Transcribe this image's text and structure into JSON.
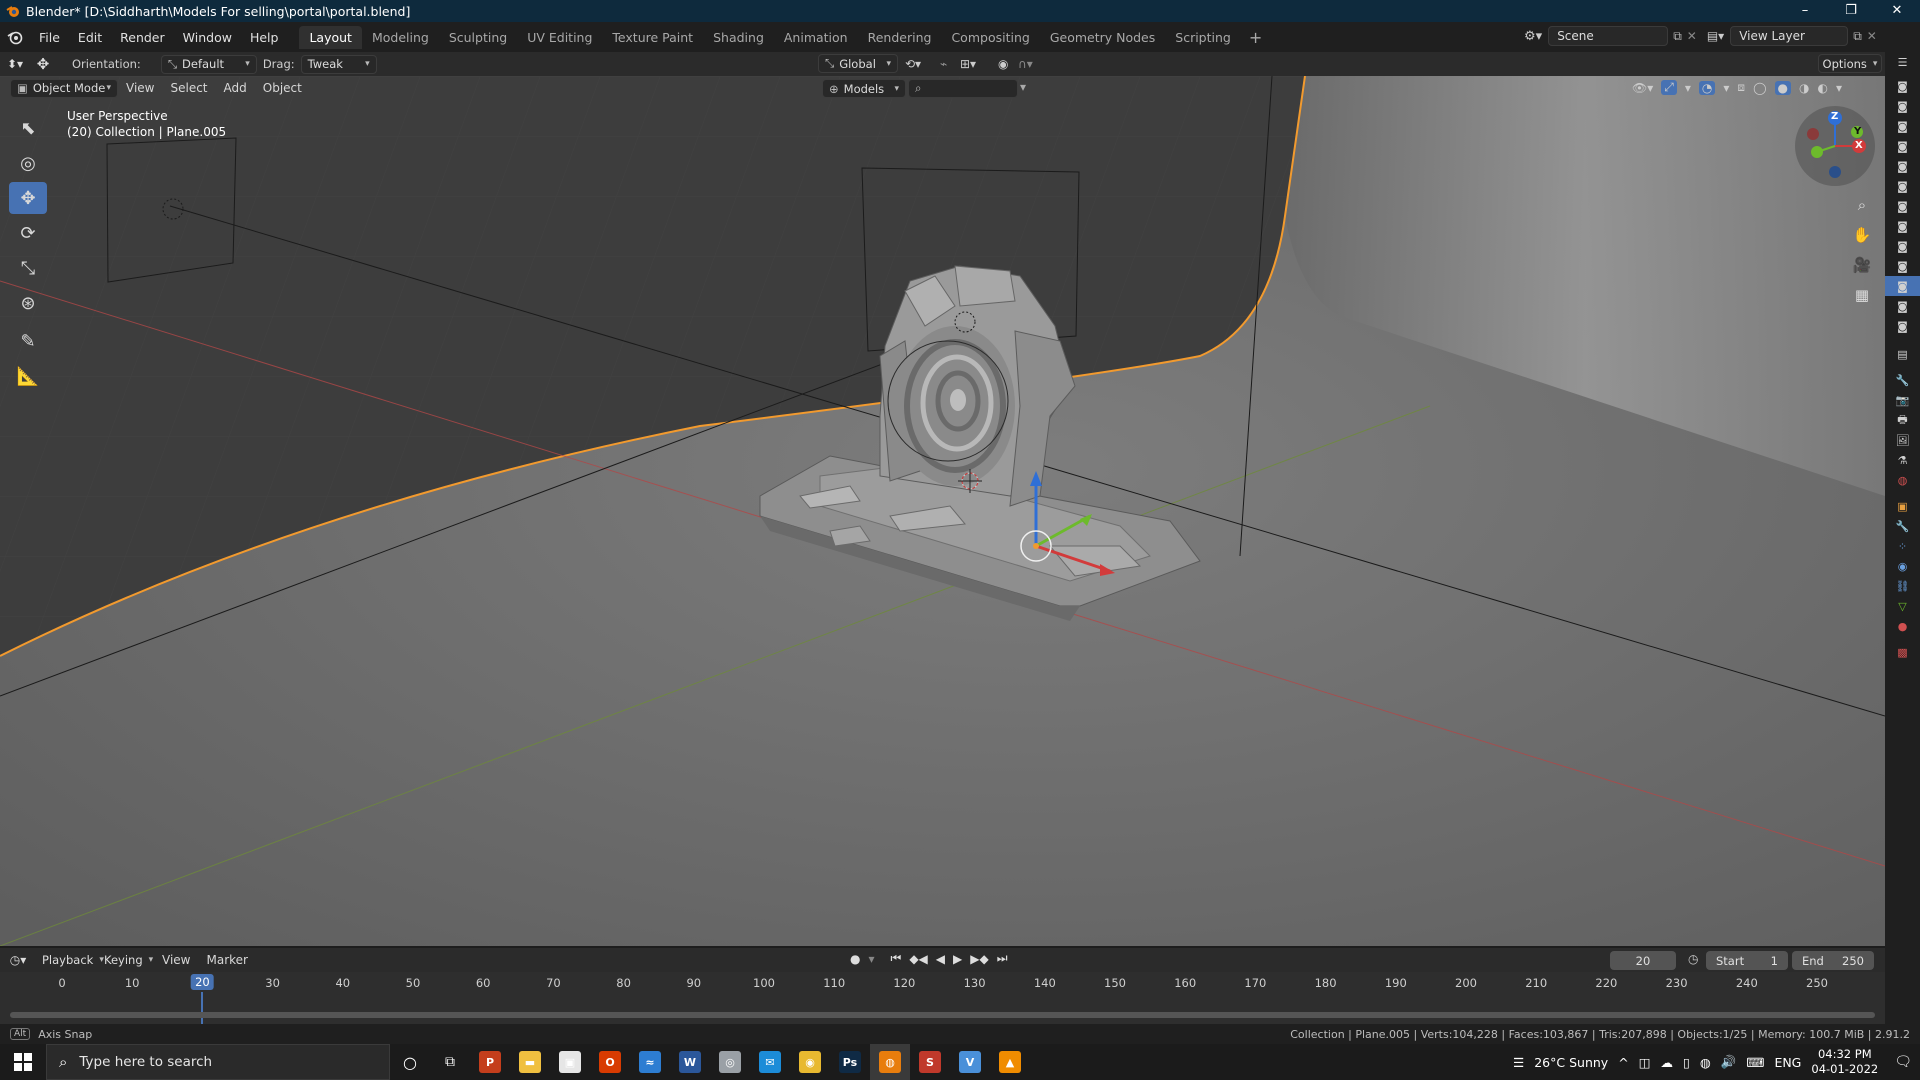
{
  "window": {
    "title": "Blender* [D:\\Siddharth\\Models For selling\\portal\\portal.blend]",
    "controls": [
      "–",
      "❐",
      "✕"
    ]
  },
  "menu": [
    "File",
    "Edit",
    "Render",
    "Window",
    "Help"
  ],
  "workspaces": [
    "Layout",
    "Modeling",
    "Sculpting",
    "UV Editing",
    "Texture Paint",
    "Shading",
    "Animation",
    "Rendering",
    "Compositing",
    "Geometry Nodes",
    "Scripting"
  ],
  "active_workspace": "Layout",
  "scene": {
    "scene_name": "Scene",
    "view_layer": "View Layer"
  },
  "tool_header": {
    "orientation_label": "Orientation:",
    "orientation_value": "Default",
    "drag_label": "Drag:",
    "drag_value": "Tweak",
    "transform_orientation": "Global",
    "options_label": "Options"
  },
  "viewport_header": {
    "mode": "Object Mode",
    "menus": [
      "View",
      "Select",
      "Add",
      "Object"
    ],
    "asset_filter": "Models"
  },
  "viewport_overlay": {
    "line1": "User Perspective",
    "line2": "(20) Collection | Plane.005"
  },
  "gizmo": {
    "z": "Z",
    "y": "Y",
    "x": "X"
  },
  "timeline": {
    "menus": [
      "Playback",
      "Keying",
      "View",
      "Marker"
    ],
    "current_frame": "20",
    "start_label": "Start",
    "start_value": "1",
    "end_label": "End",
    "end_value": "250",
    "ticks": [
      "0",
      "10",
      "20",
      "30",
      "40",
      "50",
      "60",
      "70",
      "80",
      "90",
      "100",
      "110",
      "120",
      "130",
      "140",
      "150",
      "160",
      "170",
      "180",
      "190",
      "200",
      "210",
      "220",
      "230",
      "240",
      "250"
    ]
  },
  "status": {
    "left": "Axis Snap",
    "right": "Collection | Plane.005 | Verts:104,228 | Faces:103,867 | Tris:207,898 | Objects:1/25 | Memory: 100.7 MiB | 2.91.2"
  },
  "taskbar": {
    "search_placeholder": "Type here to search",
    "weather": "26°C  Sunny",
    "language": "ENG",
    "time": "04:32 PM",
    "date": "04-01-2022",
    "apps": [
      {
        "name": "powerpoint",
        "color": "#c43e1c",
        "glyph": "P"
      },
      {
        "name": "file-explorer",
        "color": "#f0c040",
        "glyph": "▬"
      },
      {
        "name": "store",
        "color": "#e6e6e6",
        "glyph": "▣"
      },
      {
        "name": "office",
        "color": "#d83b01",
        "glyph": "O"
      },
      {
        "name": "app-blue",
        "color": "#2d7dd2",
        "glyph": "≈"
      },
      {
        "name": "word",
        "color": "#2b579a",
        "glyph": "W"
      },
      {
        "name": "app-gray",
        "color": "#9aa0a6",
        "glyph": "◎"
      },
      {
        "name": "app-mail",
        "color": "#1c8cd8",
        "glyph": "✉"
      },
      {
        "name": "chrome",
        "color": "#e8b930",
        "glyph": "◉"
      },
      {
        "name": "photoshop",
        "color": "#0f2a45",
        "glyph": "Ps"
      },
      {
        "name": "blender",
        "color": "#e87d0d",
        "glyph": "◍"
      },
      {
        "name": "app-red",
        "color": "#c0392b",
        "glyph": "S"
      },
      {
        "name": "vivaldi",
        "color": "#4a90d9",
        "glyph": "V"
      },
      {
        "name": "vlc",
        "color": "#f08c00",
        "glyph": "▲"
      }
    ]
  }
}
